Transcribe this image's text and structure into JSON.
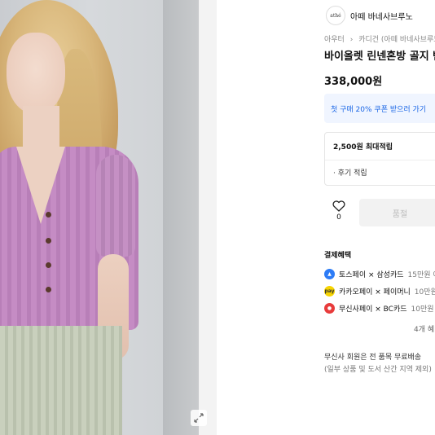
{
  "brand": {
    "logo_text": "athé",
    "name": "아떼 바네사브루노"
  },
  "breadcrumb": {
    "items": [
      "아우터",
      "카디건 (아떼 바네사브루노"
    ]
  },
  "product": {
    "title": "바이올렛 린넨혼방 골지 반",
    "price": "338,000원"
  },
  "coupon": {
    "text": "첫 구매 20% 쿠폰 받으러 가기"
  },
  "points": {
    "max": "2,500원 최대적립",
    "review": "· 후기 적립"
  },
  "actions": {
    "like_count": "0",
    "soldout_label": "품절"
  },
  "payment": {
    "title": "결제혜택",
    "items": [
      {
        "icon": "toss-pay-icon",
        "color": "#2d7cf6",
        "main": "토스페이 × 삼성카드",
        "sub": "15만원 이"
      },
      {
        "icon": "kakao-pay-icon",
        "color": "#f7d400",
        "main": "카카오페이 × 페이머니",
        "sub": "10만원"
      },
      {
        "icon": "musinsa-pay-icon",
        "color": "#e83b3b",
        "main": "무신사페이 × BC카드",
        "sub": "10만원"
      }
    ],
    "more": "4개 혜"
  },
  "shipping": {
    "line1": "무신사 회원은 전 품목 무료배송",
    "line2": "(일부 상품 및 도서 산간 지역 제외)"
  },
  "colors": {
    "accent_blue": "#1a66e6",
    "coupon_bg": "#f0f5ff",
    "cardigan": "#c58cc4"
  }
}
